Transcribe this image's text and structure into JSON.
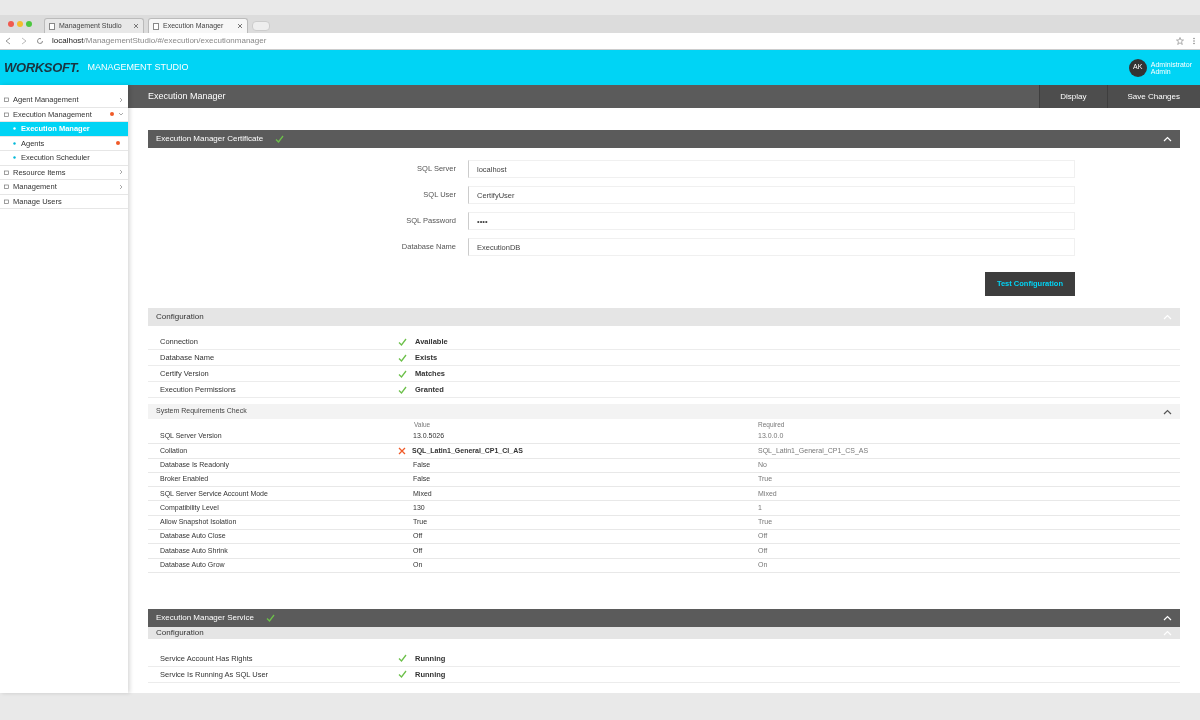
{
  "browser": {
    "tabs": [
      {
        "title": "Management Studio",
        "selected": false
      },
      {
        "title": "Execution Manager",
        "selected": true
      }
    ],
    "url_host": "localhost",
    "url_path": "/ManagementStudio/#/execution/executionmanager"
  },
  "header": {
    "logo": "WORKSOFT.",
    "product": "MANAGEMENT STUDIO",
    "avatar": "AK",
    "user": "Administrator",
    "role": "Admin"
  },
  "sidebar": {
    "items": [
      {
        "label": "Agent Management",
        "alert": false,
        "expanded": false,
        "selected": false
      },
      {
        "label": "Execution Management",
        "alert": true,
        "expanded": true,
        "selected": false,
        "children": [
          {
            "label": "Execution Manager",
            "alert": false,
            "selected": true
          },
          {
            "label": "Agents",
            "alert": true,
            "selected": false
          },
          {
            "label": "Execution Scheduler",
            "alert": false,
            "selected": false
          }
        ]
      },
      {
        "label": "Resource Items",
        "alert": false,
        "expanded": false,
        "selected": false
      },
      {
        "label": "Management",
        "alert": false,
        "expanded": false,
        "selected": false
      },
      {
        "label": "Manage Users",
        "alert": false,
        "selected": false
      }
    ]
  },
  "page": {
    "title": "Execution Manager",
    "buttons": [
      "Display",
      "Save Changes"
    ]
  },
  "certificate": {
    "title": "Execution Manager Certificate",
    "ok": true,
    "fields": [
      {
        "label": "SQL Server",
        "value": "localhost"
      },
      {
        "label": "SQL User",
        "value": "CertifyUser"
      },
      {
        "label": "SQL Password",
        "value": "••••"
      },
      {
        "label": "Database Name",
        "value": "ExecutionDB"
      }
    ],
    "button": "Test Configuration",
    "config_title": "Configuration",
    "checks": [
      {
        "label": "Connection",
        "ok": true,
        "value": "Available"
      },
      {
        "label": "Database Name",
        "ok": true,
        "value": "Exists"
      },
      {
        "label": "Certify Version",
        "ok": true,
        "value": "Matches"
      },
      {
        "label": "Execution Permissions",
        "ok": true,
        "value": "Granted"
      }
    ],
    "requirements": {
      "title": "System Requirements Check",
      "columns": [
        "Value",
        "Required"
      ],
      "rows": [
        {
          "label": "SQL Server Version",
          "ok": true,
          "value": "13.0.5026",
          "required": "13.0.0.0"
        },
        {
          "label": "Collation",
          "ok": false,
          "value": "SQL_Latin1_General_CP1_CI_AS",
          "required": "SQL_Latin1_General_CP1_CS_AS"
        },
        {
          "label": "Database Is Readonly",
          "ok": true,
          "value": "False",
          "required": "No"
        },
        {
          "label": "Broker Enabled",
          "ok": true,
          "value": "False",
          "required": "True"
        },
        {
          "label": "SQL Server Service Account Mode",
          "ok": true,
          "value": "Mixed",
          "required": "Mixed"
        },
        {
          "label": "Compatibility Level",
          "ok": true,
          "value": "130",
          "required": "1"
        },
        {
          "label": "Allow Snapshot Isolation",
          "ok": true,
          "value": "True",
          "required": "True"
        },
        {
          "label": "Database Auto Close",
          "ok": true,
          "value": "Off",
          "required": "Off"
        },
        {
          "label": "Database Auto Shrink",
          "ok": true,
          "value": "Off",
          "required": "Off"
        },
        {
          "label": "Database Auto Grow",
          "ok": true,
          "value": "On",
          "required": "On"
        }
      ]
    }
  },
  "service": {
    "title": "Execution Manager Service",
    "ok": true,
    "config_title": "Configuration",
    "checks": [
      {
        "label": "Service Account Has Rights",
        "ok": true,
        "value": "Running"
      },
      {
        "label": "Service Is Running As SQL User",
        "ok": true,
        "value": "Running"
      }
    ]
  }
}
